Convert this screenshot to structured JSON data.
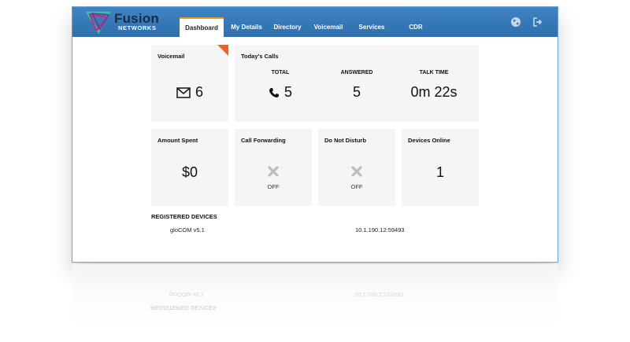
{
  "brand": {
    "name": "Fusion",
    "sub": "NETWORKS"
  },
  "tabs": [
    "Dashboard",
    "My Details",
    "Directory",
    "Voicemail",
    "Services",
    "CDR"
  ],
  "voicemail": {
    "title": "Voicemail",
    "count": "6"
  },
  "calls": {
    "title": "Today's Calls",
    "total_label": "TOTAL",
    "total": "5",
    "answered_label": "ANSWERED",
    "answered": "5",
    "talk_label": "TALK TIME",
    "talk": "0m 22s"
  },
  "amount": {
    "title": "Amount Spent",
    "value": "$0"
  },
  "forwarding": {
    "title": "Call Forwarding",
    "status": "OFF"
  },
  "dnd": {
    "title": "Do Not Disturb",
    "status": "OFF"
  },
  "devices_online": {
    "title": "Devices Online",
    "value": "1"
  },
  "registered": {
    "title": "REGISTERED DEVICES",
    "devices": [
      {
        "name": "gloCOM v5.1",
        "ip": "10.1.190.12:59493"
      }
    ]
  },
  "colors": {
    "header": "#3f84c4",
    "active_tab_accent": "#f39a1d",
    "corner_accent": "#f06322",
    "card_bg": "#f5f5f5"
  },
  "icons": {
    "voicemail": "envelope-icon",
    "calls": "phone-icon",
    "off": "x-icon",
    "globe": "globe-icon",
    "logout": "sign-out-icon"
  }
}
